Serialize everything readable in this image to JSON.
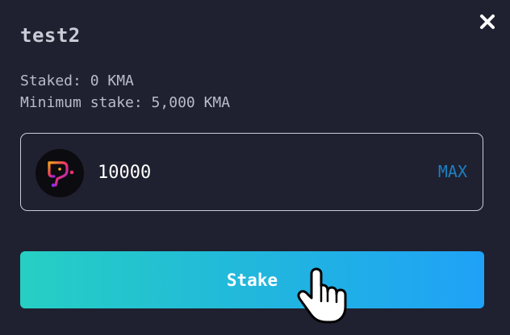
{
  "dialog": {
    "title": "test2",
    "close_icon": "close-icon",
    "staked_label": "Staked: 0 KMA",
    "minimum_label": "Minimum stake: 5,000 KMA"
  },
  "amount": {
    "value": "10000",
    "token_icon": "kma-token-icon",
    "max_label": "MAX"
  },
  "stake_button": {
    "label": "Stake"
  },
  "colors": {
    "background": "#1f2130",
    "max_link": "#1d7fc4",
    "button_gradient_start": "#26cfc3",
    "button_gradient_end": "#1fa2f7"
  },
  "cursor_icon": "hand-pointer-cursor"
}
